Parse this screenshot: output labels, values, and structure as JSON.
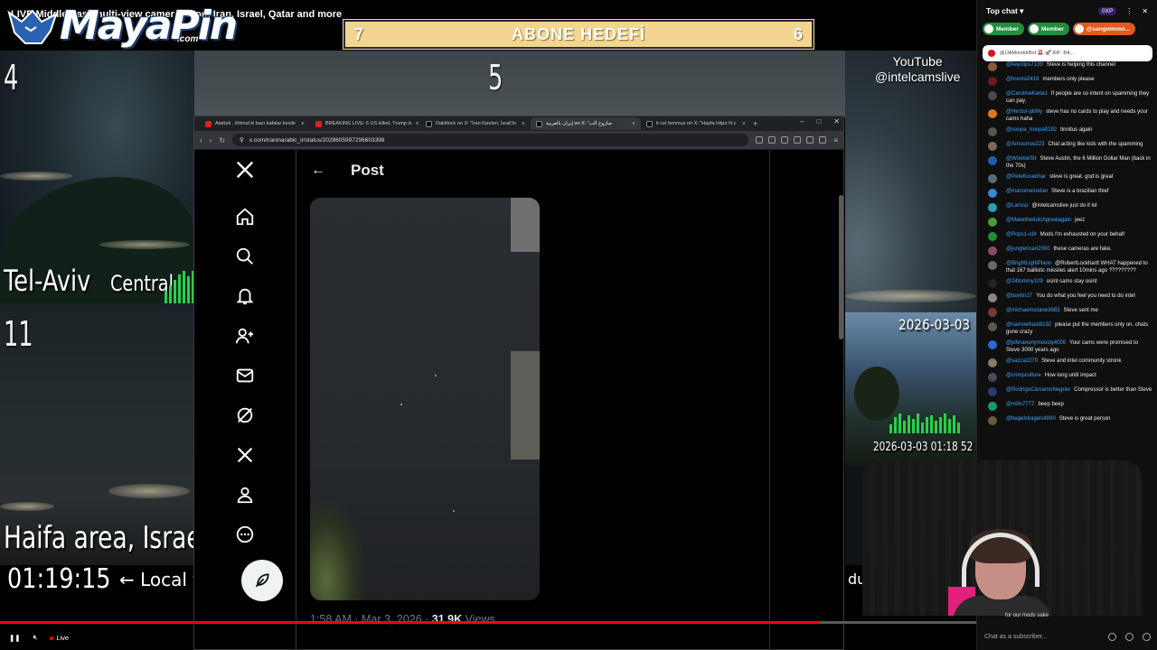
{
  "stream": {
    "title": "LIVE Middle East multi-view cameras from Iran, Israel, Qatar and more",
    "logo_text": "MayaPin",
    "logo_sub": ".com",
    "goal_left": "7",
    "goal_title": "ABONE HEDEFİ",
    "goal_right": "6",
    "yt_line1": "YouTube",
    "yt_line2": "@intelcamslive"
  },
  "cams": {
    "num4": "4",
    "num5": "5",
    "num11": "11",
    "telaviv": "Tel-Aviv",
    "central": "Central",
    "haifa": "Haifa area, Israel",
    "clock": "01:19:15",
    "local": "← Local t",
    "date_right": "2026-03-03",
    "ts_right": "2026-03-03 01:18 52",
    "du": "du"
  },
  "browser": {
    "tabs": [
      {
        "label": "Atatürk , ihtimal ki bazı kafalar kesile",
        "icon": "youtube-icon"
      },
      {
        "label": "BREAKING LIVE: 6 US killed, Trump is",
        "icon": "youtube-icon"
      },
      {
        "label": "Daktilock on X: \"İran füzeleri, İsrail'in",
        "icon": "x-icon"
      },
      {
        "label": "إيران بالعربية on X: \"صاروخ الب",
        "icon": "x-icon"
      },
      {
        "label": "it cel temmuz on X: \"Hayfa https://t.c",
        "icon": "x-icon"
      }
    ],
    "url": "x.com/iraninarabic_ir/status/2028605997296603398"
  },
  "xpost": {
    "header_title": "Post",
    "time": "1:58 AM · Mar 3, 2026 · ",
    "views_count": "31.9K",
    "views_label": " Views"
  },
  "player": {
    "live_label": "Live",
    "progress": 0.84
  },
  "chat": {
    "header": "Top chat",
    "xp": "0XP",
    "pills": [
      {
        "label": "Member",
        "color": "green"
      },
      {
        "label": "Member",
        "color": "green"
      },
      {
        "label": "@sangolmmo...",
        "color": "orange"
      }
    ],
    "pinned": "@IJAMonitorBot  🚨 🚀  IDF: BA...",
    "messages": [
      {
        "author": "@keyclips7139",
        "text": "Steve is helping this channel",
        "color": "#8a5a3c"
      },
      {
        "author": "@brento2418",
        "text": "members only please",
        "color": "#6b1b1b"
      },
      {
        "author": "@CarolineKarla1",
        "text": "If people are so intent on spamming they can pay.",
        "color": "#4a4a4a"
      },
      {
        "author": "@Hector-pb9iy",
        "text": "steve has no cards to play and needs your cams haha",
        "color": "#d87a1c"
      },
      {
        "author": "@coopa_troopa0192",
        "text": "tinnitus again",
        "color": "#555"
      },
      {
        "author": "@Amourrue223",
        "text": "Chat acting like kids with the spamming",
        "color": "#7a6a5a"
      },
      {
        "author": "@WookieStr",
        "text": "Steve Austin, the 6 Million Dollar Man (back in the 70s)",
        "color": "#2a5ab0"
      },
      {
        "author": "@PeteKosednar",
        "text": "steve is great. god is great",
        "color": "#5a6a7a"
      },
      {
        "author": "@marceneirodan",
        "text": "Steve is a brazilian thief",
        "color": "#3a8ad0"
      },
      {
        "author": "@Laroso",
        "text": "@intelcamslive just do it lol",
        "color": "#2aa0b0"
      },
      {
        "author": "@Makethedutchgreatagain",
        "text": "jeez",
        "color": "#4a9a3a"
      },
      {
        "author": "@Pops1-o9r",
        "text": "Mods  I'm exhausted on your behalf",
        "color": "#1f8f3a"
      },
      {
        "author": "@junglerican2000",
        "text": "these cameras are fake.",
        "color": "#8a4a6a"
      },
      {
        "author": "@BrightLightPiano",
        "text": "@RobertLockhartt WHAT happened to that 167 ballistic missiles alert 10mins ago ?????????",
        "color": "#6a6a6a"
      },
      {
        "author": "@24tommy109",
        "text": "osint cams stay osint",
        "color": "#222"
      },
      {
        "author": "@buntin27",
        "text": "You do what you feel you need to do intel",
        "color": "#888"
      },
      {
        "author": "@michaelmclane3683",
        "text": "Steve sent me",
        "color": "#7a3a3a"
      },
      {
        "author": "@namowhast8192",
        "text": "please put the members only on. chats gone crazy",
        "color": "#5a5a4a"
      },
      {
        "author": "@johnanonymously4055",
        "text": "Your cams were promised to Steve 3000 years ago",
        "color": "#2a6ad0"
      },
      {
        "author": "@sazza2270",
        "text": "Steve and intel community stronk",
        "color": "#8a7a6a"
      },
      {
        "author": "@crimpculture",
        "text": "How long until impact",
        "color": "#4a4a5a"
      },
      {
        "author": "@RodrigoCárcamoNegrier",
        "text": "Compressor is better than Steve",
        "color": "#2a3a6a"
      },
      {
        "author": "@mills7777",
        "text": "beep beep",
        "color": "#1a9a6a"
      },
      {
        "author": "@bagelsbagels4890",
        "text": "Steve is great person",
        "color": "#6a5a3a"
      }
    ],
    "input_placeholder": "Chat as a subscriber...",
    "note": "for our mods sake"
  }
}
